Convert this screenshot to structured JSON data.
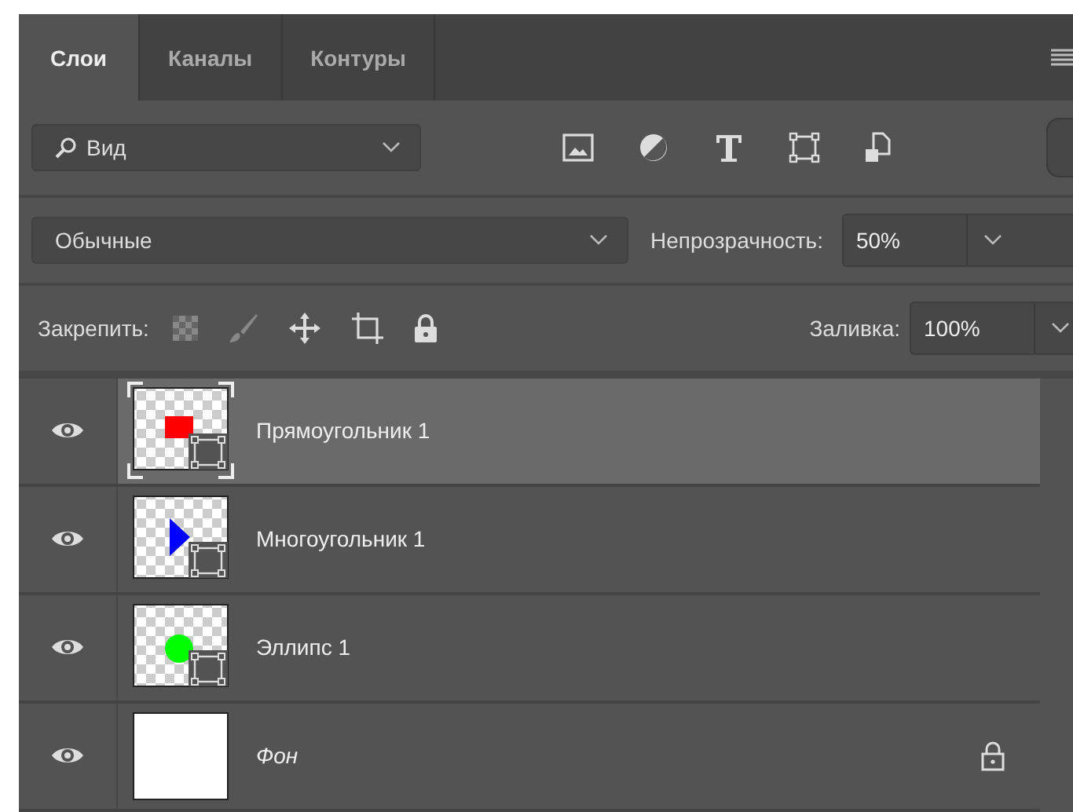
{
  "tabs": [
    {
      "label": "Слои",
      "selected": true
    },
    {
      "label": "Каналы",
      "selected": false
    },
    {
      "label": "Контуры",
      "selected": false
    }
  ],
  "filter": {
    "value": "Вид"
  },
  "blend_mode": {
    "value": "Обычные"
  },
  "opacity": {
    "label": "Непрозрачность:",
    "value": "50%"
  },
  "lock": {
    "label": "Закрепить:"
  },
  "fill": {
    "label": "Заливка:",
    "value": "100%"
  },
  "layers": [
    {
      "name": "Прямоугольник 1",
      "kind": "rectangle",
      "color": "#ff0000",
      "visible": true,
      "selected": true,
      "locked": false
    },
    {
      "name": "Многоугольник 1",
      "kind": "polygon",
      "color": "#0000ff",
      "visible": true,
      "selected": false,
      "locked": false
    },
    {
      "name": "Эллипс 1",
      "kind": "ellipse",
      "color": "#00ff00",
      "visible": true,
      "selected": false,
      "locked": false
    },
    {
      "name": "Фон",
      "kind": "background",
      "visible": true,
      "selected": false,
      "locked": true
    }
  ]
}
